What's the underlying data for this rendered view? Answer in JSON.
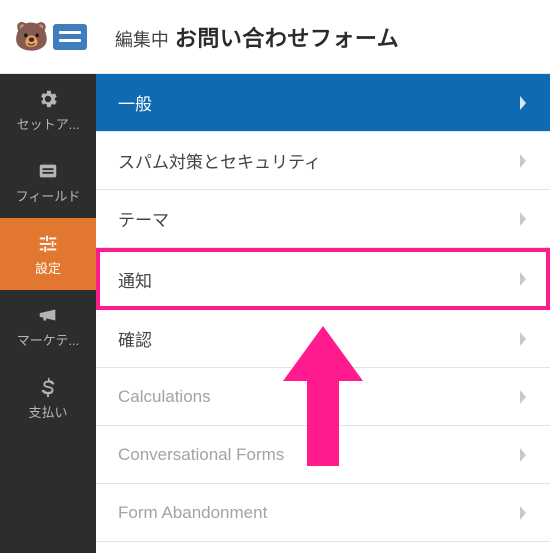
{
  "header": {
    "prefix": "編集中",
    "title": "お問い合わせフォーム",
    "logo_icon": "wpforms-bear-logo"
  },
  "sidebar": {
    "items": [
      {
        "label": "セットア...",
        "icon": "gear-icon",
        "active": false
      },
      {
        "label": "フィールド",
        "icon": "list-icon",
        "active": false
      },
      {
        "label": "設定",
        "icon": "sliders-icon",
        "active": true
      },
      {
        "label": "マーケテ...",
        "icon": "megaphone-icon",
        "active": false
      },
      {
        "label": "支払い",
        "icon": "dollar-icon",
        "active": false
      }
    ]
  },
  "settings": {
    "items": [
      {
        "label": "一般",
        "style": "primary"
      },
      {
        "label": "スパム対策とセキュリティ",
        "style": "normal"
      },
      {
        "label": "テーマ",
        "style": "normal"
      },
      {
        "label": "通知",
        "style": "highlight"
      },
      {
        "label": "確認",
        "style": "normal"
      },
      {
        "label": "Calculations",
        "style": "muted"
      },
      {
        "label": "Conversational Forms",
        "style": "muted"
      },
      {
        "label": "Form Abandonment",
        "style": "muted"
      }
    ]
  },
  "annotation": {
    "arrow_color": "#ff1b8d",
    "highlight_color": "#ff1b8d",
    "target": "通知"
  },
  "colors": {
    "sidebar_bg": "#2d2d2d",
    "sidebar_active_bg": "#e27730",
    "primary_row_bg": "#0f6ab3"
  }
}
